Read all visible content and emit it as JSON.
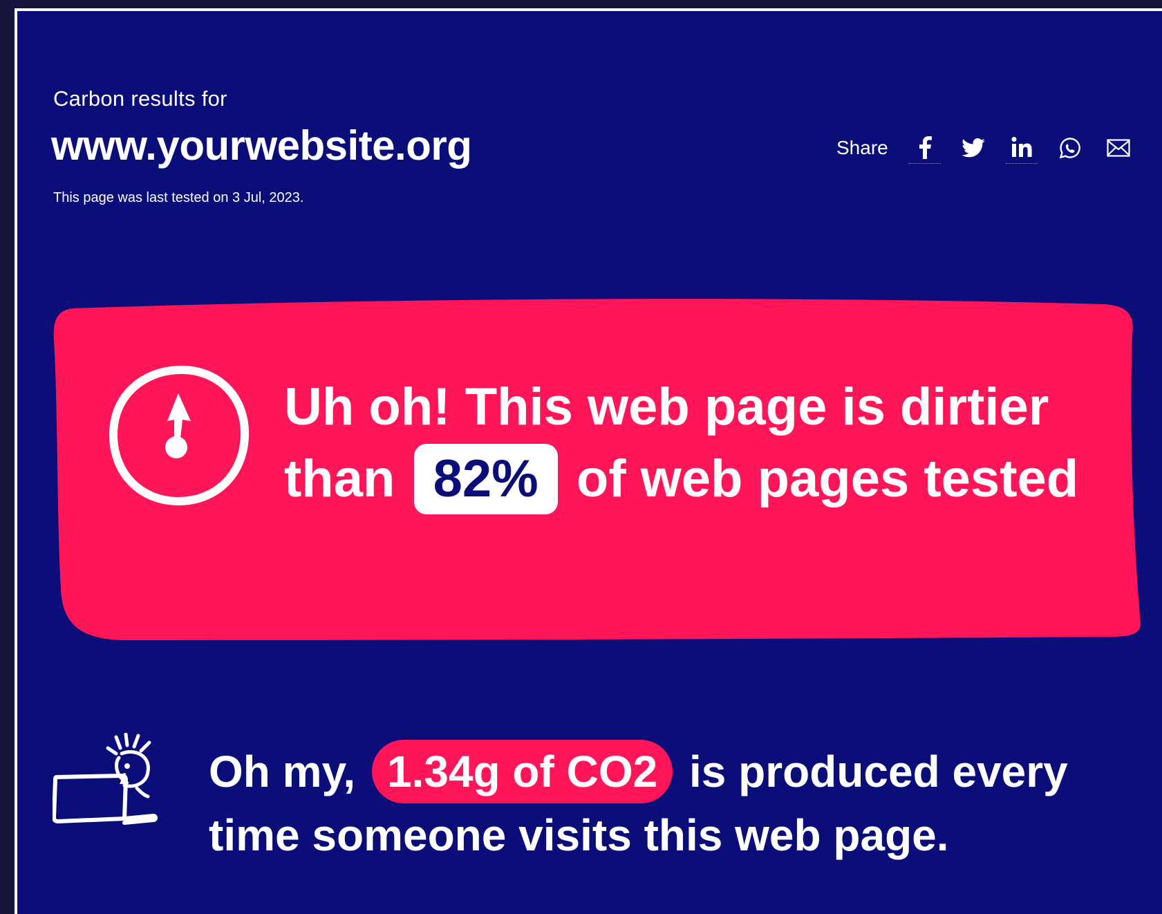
{
  "header": {
    "eyebrow": "Carbon results for",
    "site_url": "www.yourwebsite.org",
    "last_tested": "This page was last tested on 3 Jul, 2023."
  },
  "share": {
    "label": "Share",
    "buttons": [
      {
        "icon": "facebook-icon"
      },
      {
        "icon": "twitter-icon"
      },
      {
        "icon": "linkedin-icon"
      },
      {
        "icon": "whatsapp-icon"
      },
      {
        "icon": "email-icon"
      }
    ]
  },
  "result": {
    "text_before": "Uh oh! This web page is dirtier than",
    "percent": "82%",
    "text_after": "of web pages tested",
    "icon": "gauge-icon"
  },
  "emissions": {
    "text_before": "Oh my,",
    "amount": "1.34g of CO2",
    "text_after": "is produced every time someone visits this web page.",
    "icon": "laptop-person-icon"
  },
  "colors": {
    "background": "#0b0d78",
    "accent": "#ff1658",
    "text": "#ffffff"
  }
}
